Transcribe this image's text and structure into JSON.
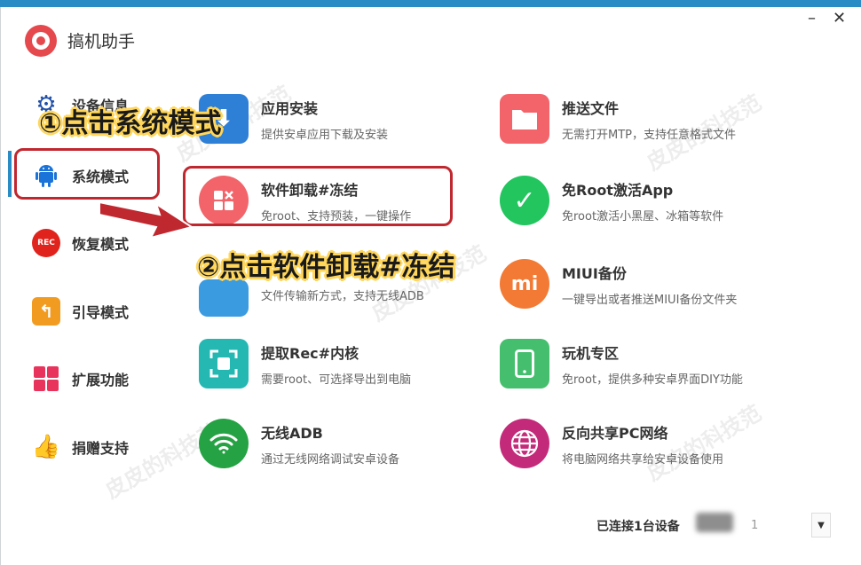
{
  "app": {
    "title": "搞机助手"
  },
  "window": {
    "minimize": "–",
    "close": "✕"
  },
  "sidebar": {
    "items": [
      {
        "label": "设备信息",
        "icon": "gear-icon",
        "color": "#1f4fa8"
      },
      {
        "label": "系统模式",
        "icon": "android-icon",
        "color": "#1a73d9"
      },
      {
        "label": "恢复模式",
        "icon": "rec-icon",
        "color": "#e0231c",
        "icon_text": "REC"
      },
      {
        "label": "引导模式",
        "icon": "back-arrow-icon",
        "color": "#f29b21"
      },
      {
        "label": "扩展功能",
        "icon": "grid-icon",
        "color": "#e8345c"
      },
      {
        "label": "捐赠支持",
        "icon": "thumbs-up-icon",
        "color": "#3aa757"
      }
    ]
  },
  "cards": [
    {
      "title": "应用安装",
      "desc": "提供安卓应用下载及安装",
      "icon": "install-icon",
      "color": "#2e7fd6"
    },
    {
      "title": "推送文件",
      "desc": "无需打开MTP，支持任意格式文件",
      "icon": "folder-icon",
      "color": "#f2646a"
    },
    {
      "title": "软件卸载#冻结",
      "desc": "免root、支持预装，一键操作",
      "icon": "uninstall-icon",
      "color": "#f2646a"
    },
    {
      "title": "免Root激活App",
      "desc": "免root激活小黑屋、冰箱等软件",
      "icon": "check-icon",
      "color": "#22c55e"
    },
    {
      "title": "",
      "desc": "文件传输新方式，支持无线ADB",
      "icon": "transfer-icon",
      "color": "#3a9be0"
    },
    {
      "title": "MIUI备份",
      "desc": "一键导出或者推送MIUI备份文件夹",
      "icon": "mi-icon",
      "color": "#f27a35",
      "icon_text": "mi"
    },
    {
      "title": "提取Rec#内核",
      "desc": "需要root、可选择导出到电脑",
      "icon": "scan-icon",
      "color": "#25b8b3"
    },
    {
      "title": "玩机专区",
      "desc": "免root，提供多种安卓界面DIY功能",
      "icon": "phone-icon",
      "color": "#45bf6e"
    },
    {
      "title": "无线ADB",
      "desc": "通过无线网络调试安卓设备",
      "icon": "wifi-icon",
      "color": "#25a244"
    },
    {
      "title": "反向共享PC网络",
      "desc": "将电脑网络共享给安卓设备使用",
      "icon": "globe-icon",
      "color": "#c42a7a"
    }
  ],
  "annotations": {
    "step1": "①点击系统模式",
    "step2": "②点击软件卸载#冻结"
  },
  "watermark": "皮皮的科技范",
  "footer": {
    "status": "已连接1台设备",
    "device_suffix": "1",
    "dropdown": "▼"
  }
}
